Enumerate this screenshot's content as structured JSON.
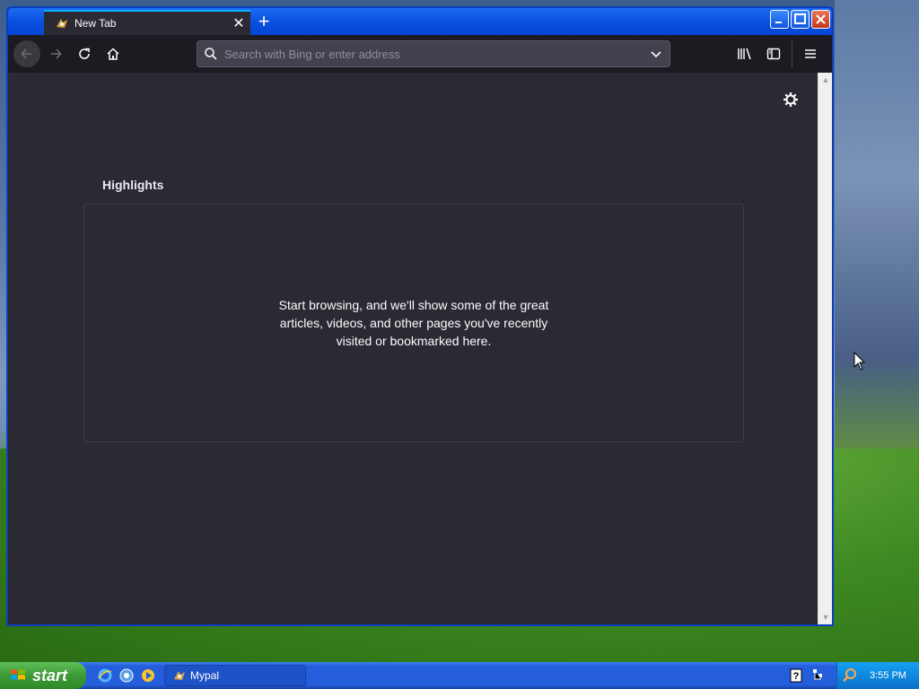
{
  "window": {
    "tab_title": "New Tab",
    "tab_close_icon": "close-icon",
    "new_tab_icon": "plus-icon",
    "controls": {
      "minimize": "minimize-icon",
      "maximize": "maximize-icon",
      "close": "close-icon"
    }
  },
  "toolbar": {
    "back_icon": "arrow-left-icon",
    "forward_icon": "arrow-right-icon",
    "reload_icon": "reload-icon",
    "home_icon": "home-icon",
    "urlbar": {
      "placeholder": "Search with Bing or enter address",
      "value": "",
      "search_icon": "search-icon",
      "dropdown_icon": "chevron-down-icon"
    },
    "library_icon": "library-icon",
    "sidebar_icon": "sidebar-icon",
    "menu_icon": "hamburger-menu-icon"
  },
  "newtab": {
    "settings_icon": "gear-icon",
    "highlights_title": "Highlights",
    "highlights_message": "Start browsing, and we'll show some of the great articles, videos, and other pages you've recently visited or bookmarked here."
  },
  "taskbar": {
    "start_label": "start",
    "task_item_label": "Mypal",
    "clock": "3:55 PM",
    "quick_launch": [
      "ie-icon",
      "media-icon",
      "messenger-icon"
    ],
    "tray_icons": [
      "help-icon",
      "network-icon",
      "search-icon"
    ]
  },
  "colors": {
    "content_bg": "#2b2a33",
    "toolbar_bg": "#1c1b22",
    "titlebar_blue": "#0a4fe0",
    "taskbar_blue": "#245edb",
    "start_green": "#3c9a35"
  }
}
